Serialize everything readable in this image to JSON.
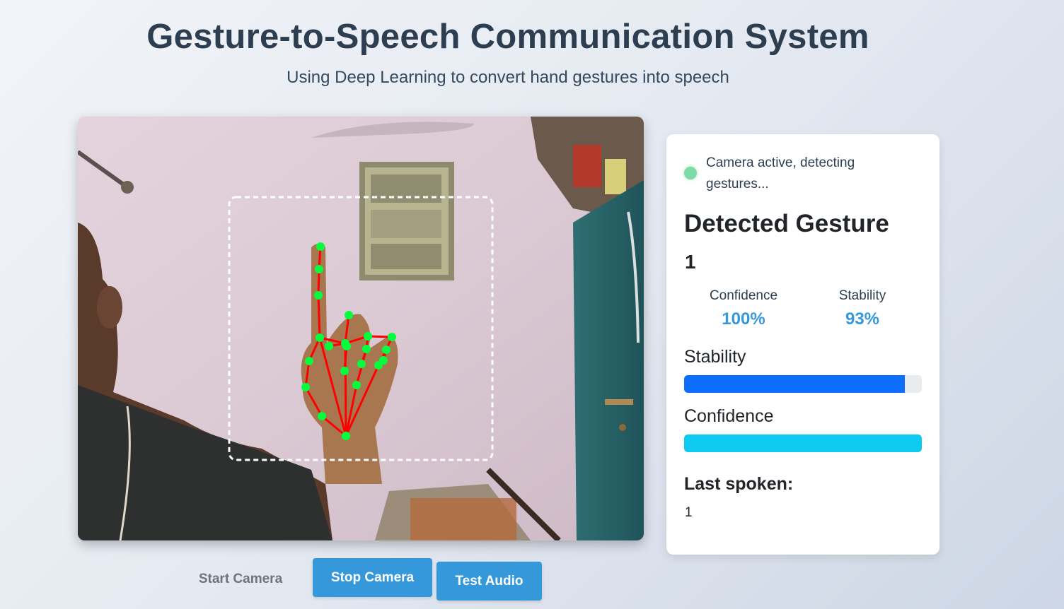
{
  "header": {
    "title": "Gesture-to-Speech Communication System",
    "subtitle": "Using Deep Learning to convert hand gestures into speech"
  },
  "controls": {
    "start_label": "Start Camera",
    "stop_label": "Stop Camera",
    "audio_label": "Test Audio"
  },
  "panel": {
    "status_text": "Camera active, detecting gestures...",
    "heading": "Detected Gesture",
    "gesture": "1",
    "confidence_label": "Confidence",
    "confidence_value": "100%",
    "stability_label": "Stability",
    "stability_value": "93%",
    "stability_bar_label": "Stability",
    "confidence_bar_label": "Confidence",
    "stability_fraction": 0.93,
    "confidence_fraction": 1.0,
    "last_spoken_label": "Last spoken:",
    "last_spoken_value": "1"
  },
  "colors": {
    "primary": "#3498db",
    "stability_bar": "#0d6efd",
    "confidence_bar": "#0dcaf0",
    "status_dot": "#7ddba8",
    "landmark": "#00ff3c",
    "skeleton": "#ff0000"
  }
}
